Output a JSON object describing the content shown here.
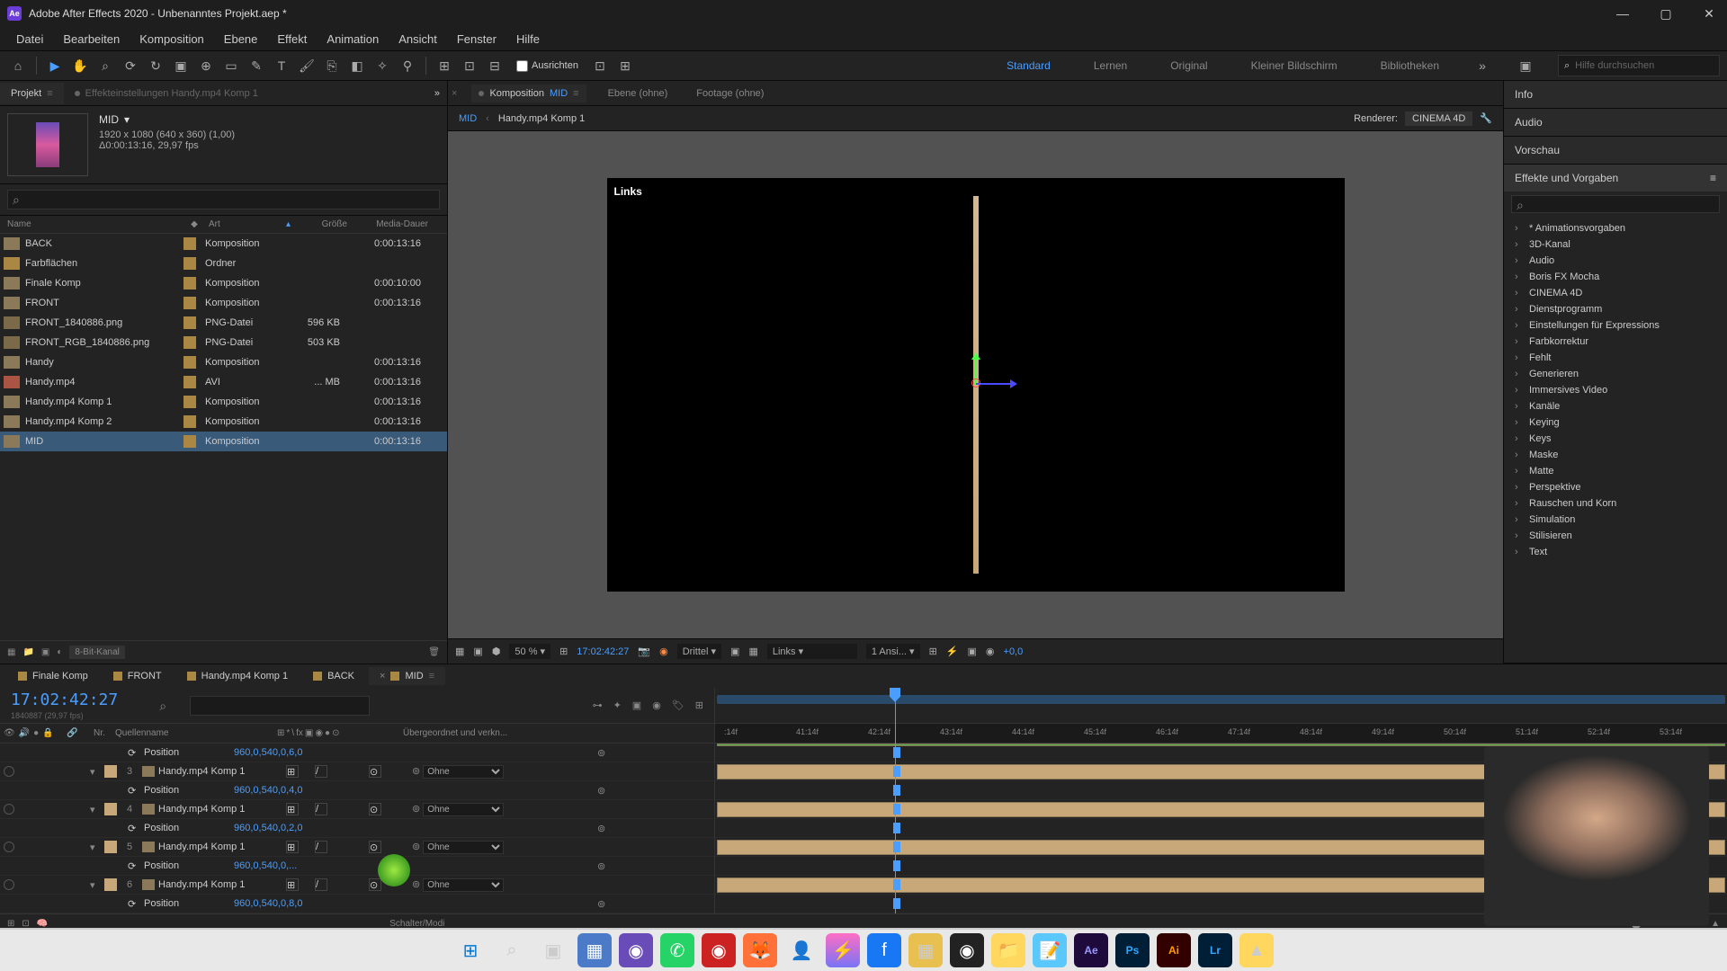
{
  "titlebar": {
    "app": "Ae",
    "title": "Adobe After Effects 2020 - Unbenanntes Projekt.aep *"
  },
  "menu": [
    "Datei",
    "Bearbeiten",
    "Komposition",
    "Ebene",
    "Effekt",
    "Animation",
    "Ansicht",
    "Fenster",
    "Hilfe"
  ],
  "toolbar": {
    "ausrichten": "Ausrichten",
    "workspaces": [
      "Standard",
      "Lernen",
      "Original",
      "Kleiner Bildschirm",
      "Bibliotheken"
    ],
    "active_workspace": "Standard",
    "search_placeholder": "Hilfe durchsuchen"
  },
  "project_panel": {
    "tabs": {
      "projekt": "Projekt",
      "effekt": "Effekteinstellungen Handy.mp4 Komp 1"
    },
    "selected_name": "MID",
    "info1": "1920 x 1080 (640 x 360) (1,00)",
    "info2": "Δ0:00:13:16, 29,97 fps",
    "columns": {
      "name": "Name",
      "art": "Art",
      "groesse": "Größe",
      "media": "Media-Dauer"
    },
    "rows": [
      {
        "name": "BACK",
        "type": "Komposition",
        "size": "",
        "dur": "0:00:13:16",
        "icon": "comp"
      },
      {
        "name": "Farbflächen",
        "type": "Ordner",
        "size": "",
        "dur": "",
        "icon": "folder"
      },
      {
        "name": "Finale Komp",
        "type": "Komposition",
        "size": "",
        "dur": "0:00:10:00",
        "icon": "comp"
      },
      {
        "name": "FRONT",
        "type": "Komposition",
        "size": "",
        "dur": "0:00:13:16",
        "icon": "comp"
      },
      {
        "name": "FRONT_1840886.png",
        "type": "PNG-Datei",
        "size": "596 KB",
        "dur": "",
        "icon": "png"
      },
      {
        "name": "FRONT_RGB_1840886.png",
        "type": "PNG-Datei",
        "size": "503 KB",
        "dur": "",
        "icon": "png"
      },
      {
        "name": "Handy",
        "type": "Komposition",
        "size": "",
        "dur": "0:00:13:16",
        "icon": "comp"
      },
      {
        "name": "Handy.mp4",
        "type": "AVI",
        "size": "... MB",
        "dur": "0:00:13:16",
        "icon": "avi"
      },
      {
        "name": "Handy.mp4 Komp 1",
        "type": "Komposition",
        "size": "",
        "dur": "0:00:13:16",
        "icon": "comp"
      },
      {
        "name": "Handy.mp4 Komp 2",
        "type": "Komposition",
        "size": "",
        "dur": "0:00:13:16",
        "icon": "comp"
      },
      {
        "name": "MID",
        "type": "Komposition",
        "size": "",
        "dur": "0:00:13:16",
        "icon": "comp",
        "selected": true
      }
    ],
    "footer": "8-Bit-Kanal"
  },
  "comp_panel": {
    "tabs": {
      "komp": "Komposition",
      "komp_name": "MID",
      "ebene": "Ebene (ohne)",
      "footage": "Footage (ohne)"
    },
    "breadcrumb": [
      "MID",
      "Handy.mp4 Komp 1"
    ],
    "renderer_label": "Renderer:",
    "renderer": "CINEMA 4D",
    "view_label": "Links",
    "controls": {
      "zoom": "50 %",
      "timecode": "17:02:42:27",
      "quality": "Drittel",
      "view": "Links",
      "views": "1 Ansi...",
      "exposure": "+0,0"
    }
  },
  "right_panel": {
    "sections": [
      "Info",
      "Audio",
      "Vorschau",
      "Effekte und Vorgaben"
    ],
    "effects": [
      "* Animationsvorgaben",
      "3D-Kanal",
      "Audio",
      "Boris FX Mocha",
      "CINEMA 4D",
      "Dienstprogramm",
      "Einstellungen für Expressions",
      "Farbkorrektur",
      "Fehlt",
      "Generieren",
      "Immersives Video",
      "Kanäle",
      "Keying",
      "Keys",
      "Maske",
      "Matte",
      "Perspektive",
      "Rauschen und Korn",
      "Simulation",
      "Stilisieren",
      "Text"
    ]
  },
  "timeline": {
    "tabs": [
      "Finale Komp",
      "FRONT",
      "Handy.mp4 Komp 1",
      "BACK",
      "MID"
    ],
    "active_tab": "MID",
    "timecode": "17:02:42:27",
    "sub": "1840887 (29,97 fps)",
    "col_head": {
      "nr": "Nr.",
      "quelle": "Quellenname",
      "parent": "Übergeordnet und verkn..."
    },
    "time_ticks": [
      ":14f",
      "41:14f",
      "42:14f",
      "43:14f",
      "44:14f",
      "45:14f",
      "46:14f",
      "47:14f",
      "48:14f",
      "49:14f",
      "50:14f",
      "51:14f",
      "52:14f",
      "53:14f"
    ],
    "layers": [
      {
        "pos": "960,0,540,0,6,0",
        "num": "",
        "name": "",
        "parent": "",
        "type": "prop",
        "prop_label": "Position"
      },
      {
        "num": "3",
        "name": "Handy.mp4 Komp 1",
        "parent": "Ohne",
        "type": "layer"
      },
      {
        "pos": "960,0,540,0,4,0",
        "type": "prop",
        "prop_label": "Position"
      },
      {
        "num": "4",
        "name": "Handy.mp4 Komp 1",
        "parent": "Ohne",
        "type": "layer"
      },
      {
        "pos": "960,0,540,0,2,0",
        "type": "prop",
        "prop_label": "Position"
      },
      {
        "num": "5",
        "name": "Handy.mp4 Komp 1",
        "parent": "Ohne",
        "type": "layer"
      },
      {
        "pos": "960,0,540,0,...",
        "type": "prop",
        "prop_label": "Position"
      },
      {
        "num": "6",
        "name": "Handy.mp4 Komp 1",
        "parent": "Ohne",
        "type": "layer"
      },
      {
        "pos": "960,0,540,0,8,0",
        "type": "prop",
        "prop_label": "Position"
      }
    ],
    "footer": "Schalter/Modi"
  }
}
